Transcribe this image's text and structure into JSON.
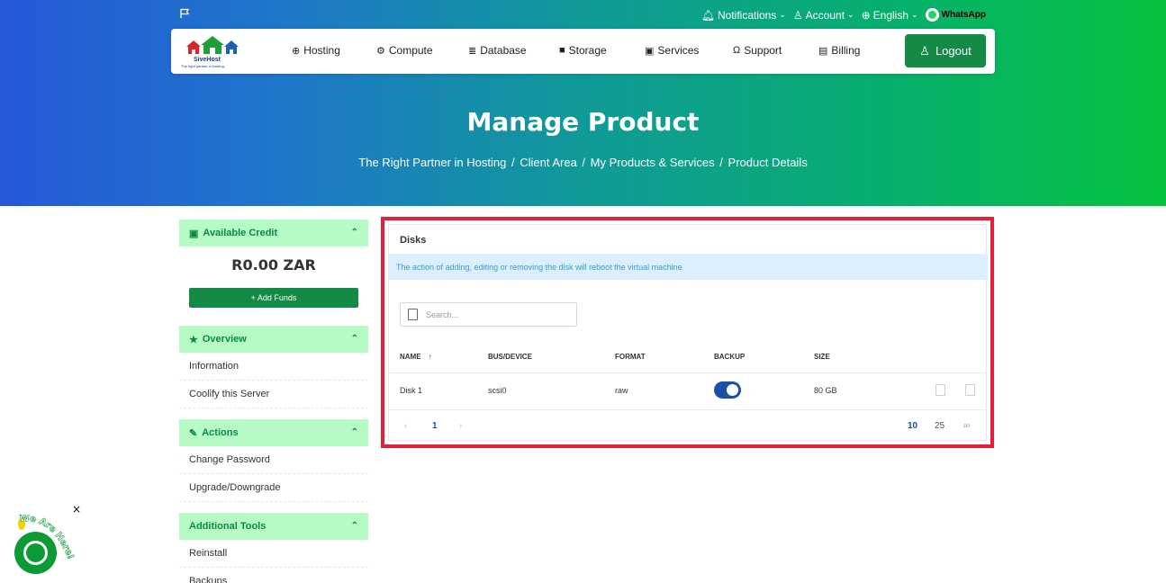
{
  "topbar": {
    "notifications": "Notifications",
    "account": "Account",
    "language": "English",
    "whatsapp": "WhatsApp"
  },
  "logo": {
    "name": "SiveHost",
    "tagline": "The right partner in hosting."
  },
  "nav": {
    "items": [
      "Hosting",
      "Compute",
      "Database",
      "Storage",
      "Services",
      "Support",
      "Billing"
    ],
    "logout": "Logout"
  },
  "hero": {
    "title": "Manage Product",
    "breadcrumb": [
      "The Right Partner in Hosting",
      "Client Area",
      "My Products & Services",
      "Product Details"
    ],
    "separator": "/"
  },
  "sidebar": {
    "credit": {
      "heading": "Available Credit",
      "amount": "R0.00 ZAR",
      "add_funds": "+ Add Funds"
    },
    "overview": {
      "heading": "Overview",
      "links": [
        "Information",
        "Coolify this Server"
      ]
    },
    "actions": {
      "heading": "Actions",
      "links": [
        "Change Password",
        "Upgrade/Downgrade"
      ]
    },
    "tools": {
      "heading": "Additional Tools",
      "links": [
        "Reinstall",
        "Backups"
      ]
    }
  },
  "disks": {
    "title": "Disks",
    "alert": "The action of adding, editing or removing the disk will reboot the virtual machine",
    "search_placeholder": "Search...",
    "columns": [
      "NAME",
      "BUS/DEVICE",
      "FORMAT",
      "BACKUP",
      "SIZE"
    ],
    "sort_indicator": "↑",
    "rows": [
      {
        "name": "Disk 1",
        "bus": "scsi0",
        "format": "raw",
        "backup": true,
        "size": "80 GB"
      }
    ],
    "pagination": {
      "prev": "‹",
      "current": "1",
      "next": "›",
      "page_sizes": [
        "10",
        "25",
        "∞"
      ]
    }
  },
  "chat": {
    "tag": "We Are Here!",
    "close": "×"
  },
  "colors": {
    "brand_green": "#138a45",
    "panel_head_bg": "#b6fbc6",
    "highlight_border": "#e41f3a",
    "toggle_on": "#1c4fa8",
    "alert_bg": "#dcefff"
  }
}
